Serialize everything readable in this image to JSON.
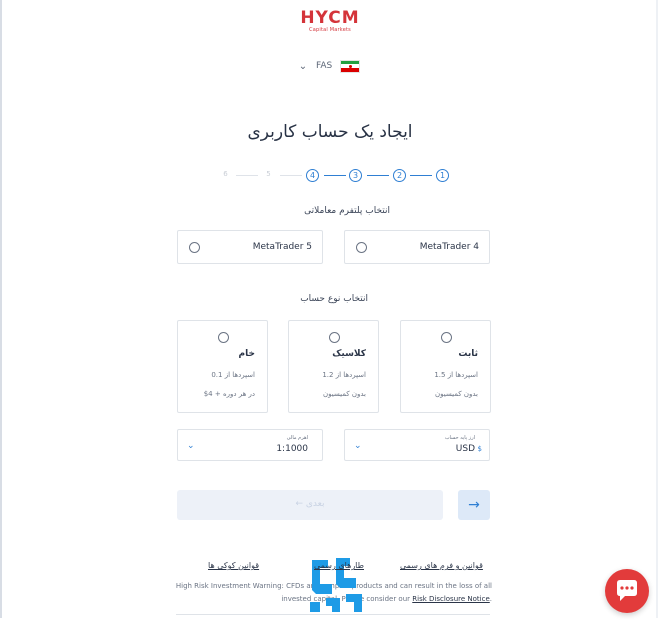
{
  "brand": {
    "logo_text": "HYCM",
    "logo_subtext": "Capital Markets",
    "color": "#d4343a"
  },
  "language": {
    "code": "FAS",
    "icon": "chevron-down-icon",
    "flag": "iran-flag-icon"
  },
  "page_title": "ایجاد یک حساب کاربری",
  "stepper": {
    "steps": [
      "1",
      "2",
      "3",
      "4",
      "5",
      "6"
    ],
    "active_color": "#2f7fd3"
  },
  "platform": {
    "label": "انتخاب پلتفرم معاملاتی",
    "options": [
      "MetaTrader 4",
      "MetaTrader 5"
    ]
  },
  "account_type": {
    "label": "انتخاب نوع حساب",
    "options": [
      {
        "name": "ثابت",
        "spread": "اسپردها از 1.5",
        "commission": "بدون کمیسیون"
      },
      {
        "name": "کلاسیک",
        "spread": "اسپردها از 1.2",
        "commission": "بدون کمیسیون"
      },
      {
        "name": "خام",
        "spread": "اسپردها از 0.1",
        "commission": "در هر دوره + 4$"
      }
    ]
  },
  "currency": {
    "label": "ارز پایه حساب",
    "symbol": "$",
    "value": "USD"
  },
  "leverage": {
    "label": "اهرم مالی",
    "value": "1:1000"
  },
  "buttons": {
    "next": "بعدی",
    "back_icon": "arrow-right-icon"
  },
  "footer": {
    "links": [
      "قوانین و فرم های رسمی",
      "قوانین کوکی ها"
    ],
    "warning_text": "High Risk Investment Warning: CFDs are complex products and can result in the loss of all invested capital. Please consider our",
    "warning_link": "Risk Disclosure Notice",
    "watermark_text": "طارهای رسمی"
  },
  "chat": {
    "icon": "chat-bubble-icon",
    "color": "#e23b3b"
  }
}
